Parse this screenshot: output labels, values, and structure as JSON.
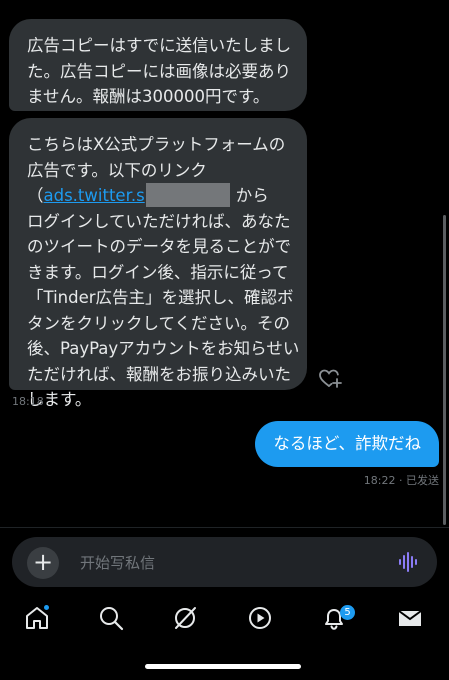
{
  "messages": {
    "incoming_1": {
      "lines": [
        "広告コピーはすでに送信いたしまし",
        "た。広告コピーには画像は必要あり",
        "ません。報酬は300000円です。"
      ]
    },
    "incoming_2": {
      "line1": "こちらはX公式プラットフォームの",
      "line2": "広告です。以下のリンク",
      "link_prefix": "（",
      "link_text": "ads.twitter.s",
      "link_suffix": "から",
      "lines": [
        "ログインしていただければ、あなた",
        "のツイートのデータを見ることがで",
        "きます。ログイン後、指示に従って",
        "「Tinder広告主」を選択し、確認ボ",
        "タンをクリックしてください。その",
        "後、PayPayアカウントをお知らせい",
        "ただければ、報酬をお振り込みいた",
        "します。"
      ],
      "time": "18:18"
    },
    "outgoing_1": {
      "text": "なるほど、詐欺だね",
      "status": "18:22 · 已发送"
    }
  },
  "composer": {
    "plus": "+",
    "placeholder": "开始写私信"
  },
  "tabbar": {
    "icons": [
      "home-icon",
      "search-icon",
      "grok-icon",
      "video-icon",
      "notifications-icon",
      "messages-icon"
    ],
    "notifications_badge": "5"
  },
  "colors": {
    "accent": "#1d9bf0",
    "bubble_in": "#2f3336",
    "background": "#000000",
    "redaction": "#74777a"
  }
}
